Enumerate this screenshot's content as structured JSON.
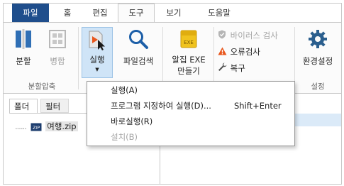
{
  "tabs": [
    {
      "label": "파일"
    },
    {
      "label": "홈"
    },
    {
      "label": "편집"
    },
    {
      "label": "도구"
    },
    {
      "label": "보기"
    },
    {
      "label": "도움말"
    }
  ],
  "ribbon": {
    "split": "분할",
    "merge": "병합",
    "split_group": "분할압축",
    "run": "실행",
    "file_search": "파일검색",
    "exe_line1": "알집 EXE",
    "exe_line2": "만들기",
    "exe_icon_text": "EXE",
    "virus_scan": "바이러스 검사",
    "error_check": "오류검사",
    "restore": "복구",
    "settings": "환경설정",
    "settings_group": "설정"
  },
  "pane": {
    "tab_folder": "폴더",
    "tab_filter": "필터",
    "tree_item": "여행.zip",
    "zip_icon_text": "ZIP"
  },
  "menu": {
    "items": [
      {
        "label": "실행(A)",
        "shortcut": ""
      },
      {
        "label": "프로그램 지정하여 실행(D)...",
        "shortcut": "Shift+Enter"
      },
      {
        "label": "바로실행(R)",
        "shortcut": ""
      },
      {
        "label": "설치(B)",
        "shortcut": ""
      }
    ]
  },
  "colors": {
    "file_tab": "#1f4e8c",
    "highlight": "#cfe4f7",
    "split_blue": "#2f6fb5",
    "search_blue": "#1d5fa8",
    "exe_yellow": "#f0c31e",
    "warning_orange": "#e8561c",
    "gear_blue": "#2b5f8e"
  }
}
